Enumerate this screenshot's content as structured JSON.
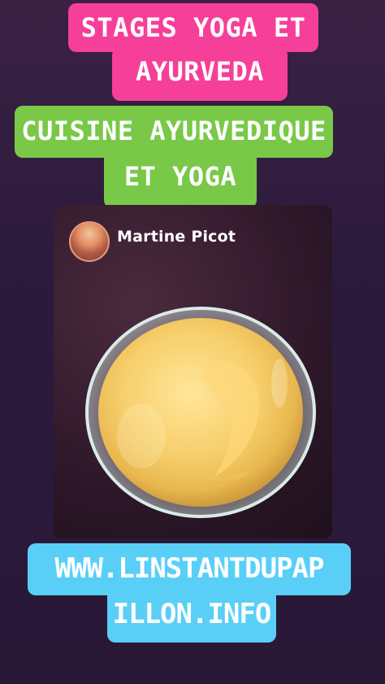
{
  "title": {
    "line1": "STAGES YOGA ET",
    "line2": "AYURVEDA"
  },
  "subtitle": {
    "line1": "CUISINE AYURVEDIQUE",
    "line2": "ET YOGA"
  },
  "post": {
    "author": "Martine Picot",
    "image_desc_icon": "ghee-jar-photo"
  },
  "website": {
    "line1": "WWW.LINSTANTDUPAP",
    "line2": "ILLON.INFO"
  },
  "colors": {
    "pink": "#f63f99",
    "green": "#79c848",
    "cyan": "#59cff7",
    "background": "#2b1a3b"
  }
}
